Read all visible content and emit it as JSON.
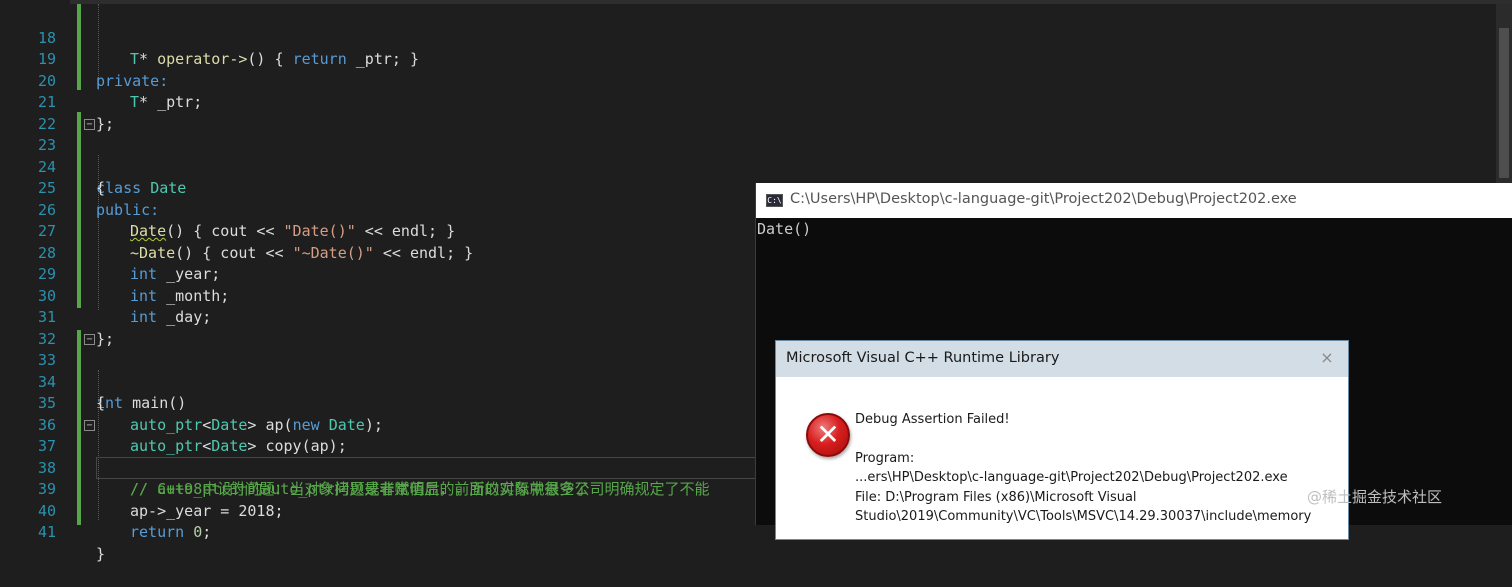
{
  "editor": {
    "lines": [
      {
        "num": "18"
      },
      {
        "num": "19"
      },
      {
        "num": "20"
      },
      {
        "num": "21"
      },
      {
        "num": "22"
      },
      {
        "num": "23"
      },
      {
        "num": "24"
      },
      {
        "num": "25"
      },
      {
        "num": "26"
      },
      {
        "num": "27"
      },
      {
        "num": "28"
      },
      {
        "num": "29"
      },
      {
        "num": "30"
      },
      {
        "num": "31"
      },
      {
        "num": "32"
      },
      {
        "num": "33"
      },
      {
        "num": "34"
      },
      {
        "num": "35"
      },
      {
        "num": "36"
      },
      {
        "num": "37"
      },
      {
        "num": "38"
      },
      {
        "num": "39"
      },
      {
        "num": "40"
      },
      {
        "num": "41"
      }
    ],
    "code": {
      "l18": "T* operator->() { return _ptr; }",
      "l19": "private:",
      "l20": "T* _ptr;",
      "l21": "};",
      "l23": "class Date",
      "l24": "{",
      "l25": "public:",
      "l26": "Date() { cout << \"Date()\" << endl; }",
      "l27": "~Date() { cout << \"~Date()\" << endl; }",
      "l28": "int _year;",
      "l29": "int _month;",
      "l30": "int _day;",
      "l31": "};",
      "l33": "int main()",
      "l34": "{",
      "l35": "auto_ptr<Date> ap(new Date);",
      "l36": "auto_ptr<Date> copy(ap);",
      "l37": "// auto_ptr的问题：当对象拷贝或者赋值后，前面的对象就悬空了",
      "l38": "// C++98中设计的auto_ptr问题是非常明显的，所以实际中很多公司明确规定了不能",
      "l39": "ap->_year = 2018;",
      "l40": "return 0;",
      "l41": "}"
    },
    "colors": {
      "keyword": "#569cd6",
      "type": "#4ec9b0",
      "function": "#dcdcaa",
      "string": "#d69d85",
      "comment": "#57a64a",
      "line_number": "#2b91af"
    }
  },
  "console": {
    "icon_label": "C:\\",
    "title": "C:\\Users\\HP\\Desktop\\c-language-git\\Project202\\Debug\\Project202.exe",
    "output": "Date()"
  },
  "dialog": {
    "title": "Microsoft Visual C++ Runtime Library",
    "close_icon": "×",
    "icon": "error-icon",
    "heading": "Debug Assertion Failed!",
    "program_label": "Program:",
    "program_path": "...ers\\HP\\Desktop\\c-language-git\\Project202\\Debug\\Project202.exe",
    "file_line1": "File: D:\\Program Files (x86)\\Microsoft Visual",
    "file_line2": "Studio\\2019\\Community\\VC\\Tools\\MSVC\\14.29.30037\\include\\memory"
  },
  "watermark": "@稀土掘金技术社区"
}
